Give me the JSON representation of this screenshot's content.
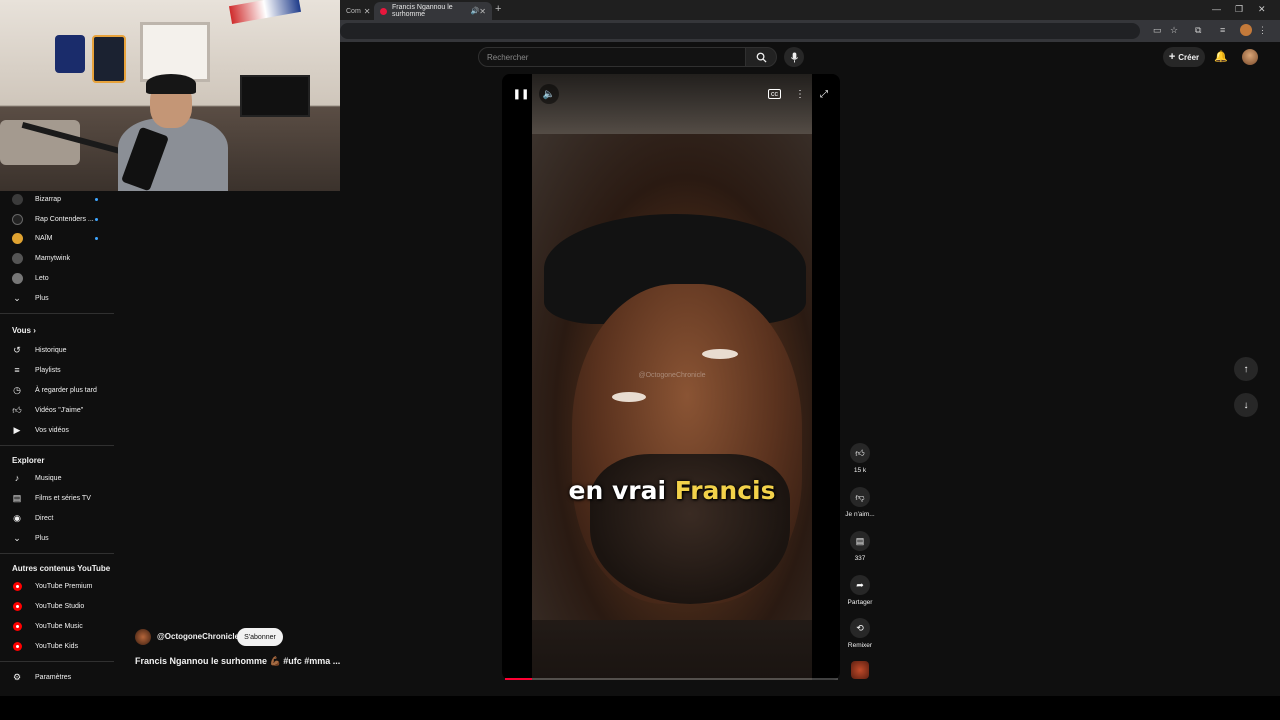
{
  "browser": {
    "inactive_tab_label": "Com",
    "active_tab_label": "Francis Ngannou le surhomme",
    "new_tab_icon": "plus-icon",
    "window_controls": [
      "minimize-icon",
      "maximize-icon",
      "close-icon"
    ]
  },
  "header": {
    "search_placeholder": "Rechercher",
    "search_icon": "search-icon",
    "mic_icon": "mic-icon",
    "create_label": "Créer",
    "bell_icon": "bell-icon"
  },
  "sidebar": {
    "subscriptions": [
      {
        "label": "Bizarrap",
        "new": true,
        "avatar_color": "#3b3b3b"
      },
      {
        "label": "Rap Contenders ...",
        "new": true,
        "avatar_color": "#222222"
      },
      {
        "label": "NAÏM",
        "new": true,
        "avatar_color": "#e0a331"
      },
      {
        "label": "Mamytwink",
        "new": false,
        "avatar_color": "#555555"
      },
      {
        "label": "Leto",
        "new": false,
        "avatar_color": "#777777"
      },
      {
        "label": "Plus",
        "new": false
      }
    ],
    "you_title": "Vous",
    "you_items": [
      {
        "label": "Historique",
        "icon": "history-icon"
      },
      {
        "label": "Playlists",
        "icon": "playlist-icon"
      },
      {
        "label": "À regarder plus tard",
        "icon": "clock-icon"
      },
      {
        "label": "Vidéos \"J'aime\"",
        "icon": "thumbs-up-icon"
      },
      {
        "label": "Vos vidéos",
        "icon": "play-square-icon"
      }
    ],
    "explore_title": "Explorer",
    "explore_items": [
      {
        "label": "Musique",
        "icon": "music-note-icon"
      },
      {
        "label": "Films et séries TV",
        "icon": "film-icon"
      },
      {
        "label": "Direct",
        "icon": "live-icon"
      },
      {
        "label": "Plus",
        "icon": "chevron-down-icon"
      }
    ],
    "more_title": "Autres contenus YouTube",
    "more_items": [
      {
        "label": "YouTube Premium"
      },
      {
        "label": "YouTube Studio"
      },
      {
        "label": "YouTube Music"
      },
      {
        "label": "YouTube Kids"
      }
    ],
    "settings_label": "Paramètres"
  },
  "player": {
    "caption_plain": "en vrai ",
    "caption_highlight": "Francis",
    "watermark": "@OctogoneChronicle",
    "progress": 0.08,
    "controls": [
      "pause-icon",
      "volume-icon",
      "captions-icon",
      "more-icon",
      "fullscreen-icon"
    ]
  },
  "actions": {
    "like_count": "15 k",
    "dislike_label": "Je n'aim...",
    "comments_count": "337",
    "share_label": "Partager",
    "remix_label": "Remixer"
  },
  "video": {
    "channel_handle": "@OctogoneChronicle",
    "subscribe_label": "S'abonner",
    "title": "Francis Ngannou le surhomme 💪🏾 #ufc #mma ..."
  },
  "colors": {
    "accent": "#ff0033",
    "caption_highlight": "#f3d24a",
    "background": "#0f0f0f"
  }
}
